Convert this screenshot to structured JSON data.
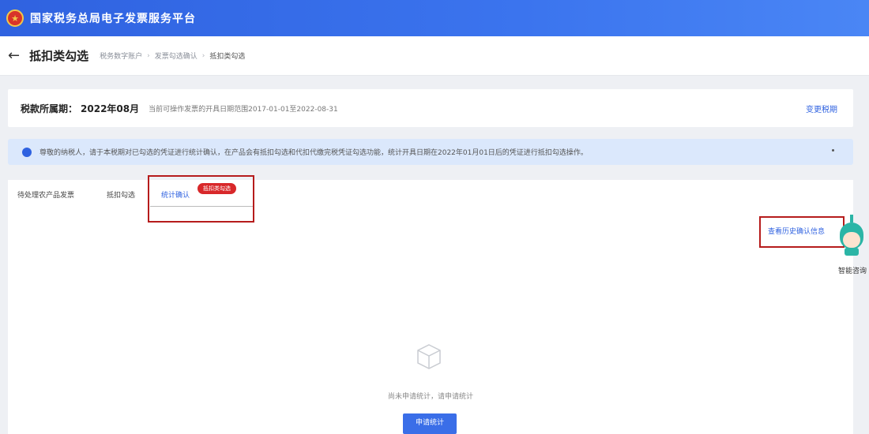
{
  "topbar": {
    "title": "国家税务总局电子发票服务平台",
    "brand_color": "#2f62e0"
  },
  "header": {
    "title": "抵扣类勾选",
    "breadcrumbs": [
      "税务数字账户",
      "发票勾选确认",
      "抵扣类勾选"
    ]
  },
  "period": {
    "label": "税款所属期：",
    "value": "2022年08月",
    "note": "当前可操作发票的开具日期范围2017-01-01至2022-08-31",
    "change_label": "变更税期"
  },
  "notice": {
    "text": "尊敬的纳税人，请于本税期对已勾选的凭证进行统计确认，在产品会有抵扣勾选和代扣代缴完税凭证勾选功能，统计开具日期在2022年01月01日后的凭证进行抵扣勾选操作。"
  },
  "tabs": [
    {
      "label": "待处理农产品发票"
    },
    {
      "label": "抵扣勾选"
    },
    {
      "label": "统计确认",
      "active": true,
      "badge": "抵扣类勾选"
    }
  ],
  "content": {
    "view_all_label": "查看历史确认信息",
    "empty_text": "尚未申请统计，请申请统计",
    "primary_button": "申请统计"
  },
  "assistant": {
    "label": "智能咨询"
  },
  "colors": {
    "highlight_border": "#b61c1c",
    "badge": "#d8282a",
    "notice_bg": "#dbe8fc"
  }
}
